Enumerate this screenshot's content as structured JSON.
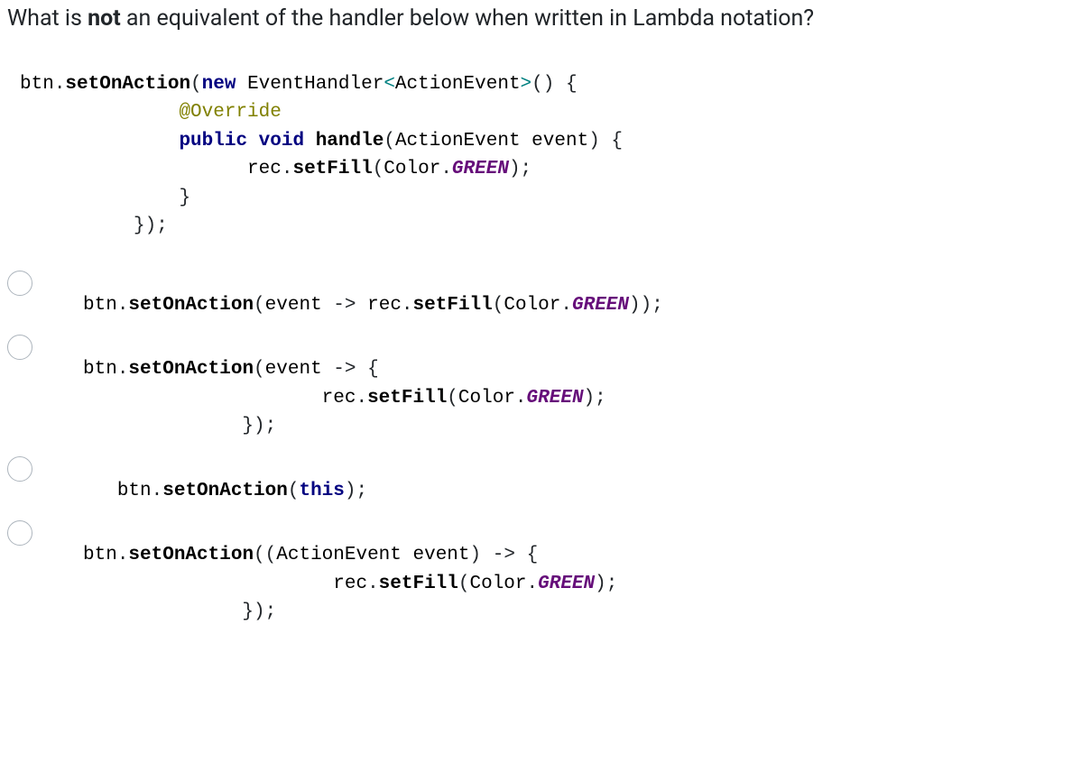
{
  "question": {
    "prefix": "What is ",
    "bold": "not",
    "suffix": " an equivalent of the handler below when written in Lambda notation?"
  },
  "code": {
    "t_btn": "btn",
    "dot": ".",
    "setOnAction": "setOnAction",
    "lp": "(",
    "rp": ")",
    "new": "new",
    "sp": " ",
    "EventHandler": "EventHandler",
    "lt": "<",
    "ActionEvent": "ActionEvent",
    "gt": ">",
    "empty_paren": "()",
    "lb": "{",
    "rb": "}",
    "override": "@Override",
    "public": "public",
    "void": "void",
    "handle": "handle",
    "event": "event",
    "rec": "rec",
    "setFill": "setFill",
    "Color": "Color",
    "GREEN": "GREEN",
    "semi": ";",
    "close_paren_semi": ");",
    "close_brace_paren_semi": "});",
    "arrow": "->",
    "this": "this"
  },
  "indent": {
    "i14": "              ",
    "i20": "                    ",
    "i10_close": "          });",
    "opt2_arrow_open": " -> {",
    "opt_indent_body": "                     ",
    "opt_close": "              });",
    "opt4_body": "                      ",
    "opt4_close": "              });"
  },
  "options": {
    "a_prefix": "btn",
    "c_pad": "   "
  }
}
